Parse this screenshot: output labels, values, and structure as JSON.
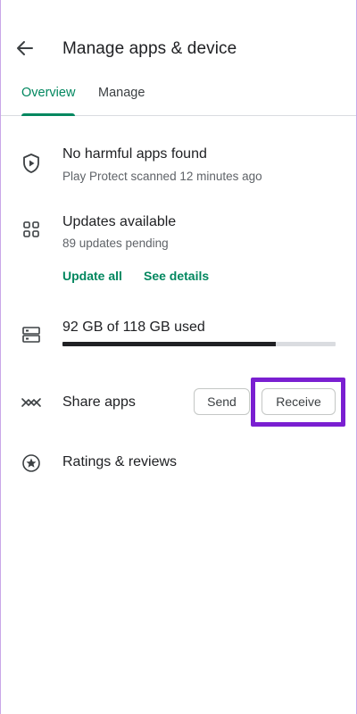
{
  "header": {
    "title": "Manage apps & device"
  },
  "tabs": [
    {
      "label": "Overview",
      "selected": true
    },
    {
      "label": "Manage",
      "selected": false
    }
  ],
  "protect": {
    "title": "No harmful apps found",
    "subtitle": "Play Protect scanned 12 minutes ago",
    "icon": "shield-play-icon"
  },
  "updates": {
    "title": "Updates available",
    "subtitle": "89 updates pending",
    "update_all_label": "Update all",
    "see_details_label": "See details",
    "icon": "apps-grid-icon"
  },
  "storage": {
    "label": "92 GB of 118 GB used",
    "used_gb": 92,
    "total_gb": 118,
    "icon": "storage-icon"
  },
  "share": {
    "label": "Share apps",
    "send_label": "Send",
    "receive_label": "Receive",
    "icon": "share-arrows-icon"
  },
  "ratings": {
    "label": "Ratings & reviews",
    "icon": "star-circle-icon"
  },
  "colors": {
    "accent": "#01875f",
    "highlight": "#7a1fd1"
  }
}
